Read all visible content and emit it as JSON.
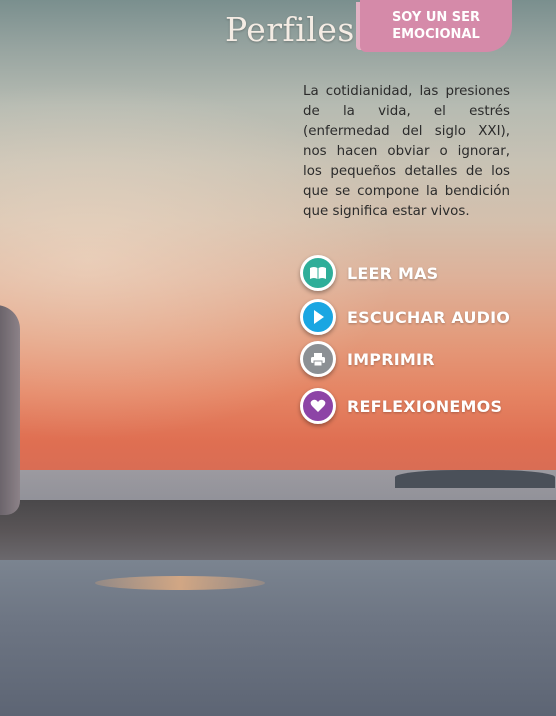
{
  "header": {
    "logo_text": "Perfiles",
    "badge_line1": "SOY UN SER",
    "badge_line2": "EMOCIONAL",
    "badge_color": "#d58aa9"
  },
  "intro": {
    "text": "La cotidianidad, las presiones de la vida, el estrés (enfermedad del siglo XXI), nos hacen obviar o ignorar, los pequeños detalles de los que se compone la bendición que significa estar vivos."
  },
  "actions": [
    {
      "label": "LEER MAS",
      "icon": "book-icon",
      "color": "#2fae99"
    },
    {
      "label": "ESCUCHAR AUDIO",
      "icon": "play-icon",
      "color": "#1aa6e2"
    },
    {
      "label": "IMPRIMIR",
      "icon": "printer-icon",
      "color": "#8c9094"
    },
    {
      "label": "REFLEXIONEMOS",
      "icon": "heart-icon",
      "color": "#8d44a6"
    }
  ]
}
